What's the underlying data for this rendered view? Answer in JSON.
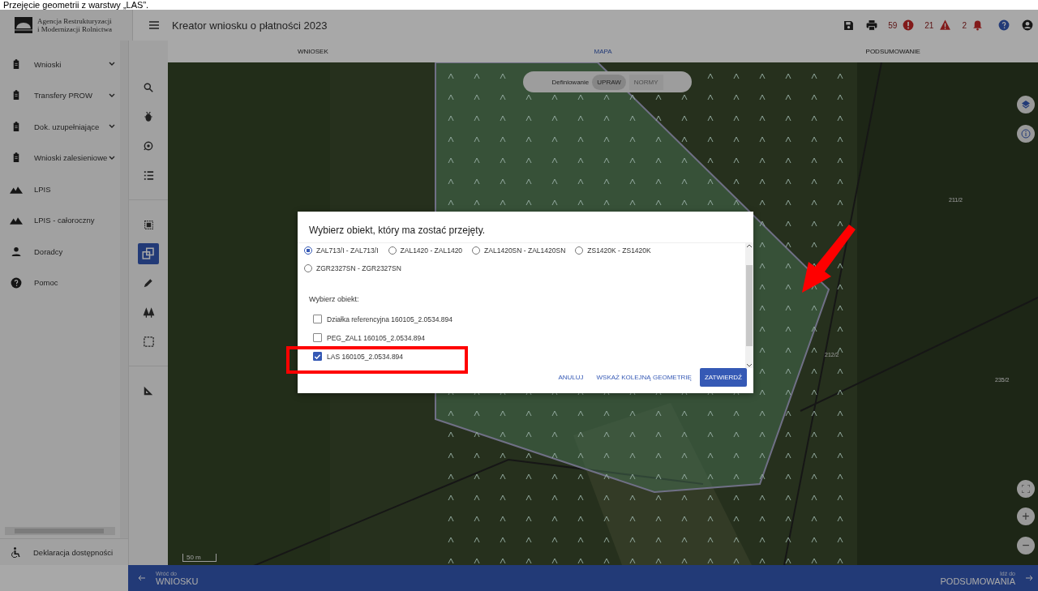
{
  "caption": "Przejęcie geometrii z warstwy „LAS”.",
  "header": {
    "logo_lines": [
      "Agencja Restrukturyzacji",
      "i Modernizacji Rolnictwa"
    ],
    "title": "Kreator wniosku o płatności 2023",
    "counters": [
      {
        "count": "59",
        "kind": "error"
      },
      {
        "count": "21",
        "kind": "warning"
      },
      {
        "count": "2",
        "kind": "notice"
      }
    ]
  },
  "tabs": [
    {
      "label": "WNIOSEK",
      "selected": false
    },
    {
      "label": "MAPA",
      "selected": true
    },
    {
      "label": "PODSUMOWANIE",
      "selected": false
    }
  ],
  "sidebar": {
    "items": [
      {
        "label": "Wnioski",
        "kind": "document",
        "expandable": true
      },
      {
        "label": "Transfery PROW",
        "kind": "document",
        "expandable": true
      },
      {
        "label": "Dok. uzupełniające",
        "kind": "document",
        "expandable": true
      },
      {
        "label": "Wnioski zalesieniowe",
        "kind": "document",
        "expandable": true
      },
      {
        "label": "LPIS",
        "kind": "terrain",
        "expandable": false
      },
      {
        "label": "LPIS - całoroczny",
        "kind": "terrain",
        "expandable": false
      },
      {
        "label": "Doradcy",
        "kind": "person",
        "expandable": false
      },
      {
        "label": "Pomoc",
        "kind": "help",
        "expandable": false
      }
    ],
    "footer": "Deklaracja dostępności"
  },
  "tools": [
    {
      "kind": "search",
      "selected": false
    },
    {
      "kind": "bug",
      "selected": false
    },
    {
      "kind": "target",
      "selected": false
    },
    {
      "kind": "list",
      "selected": false
    },
    {
      "kind": "sep"
    },
    {
      "kind": "frame",
      "selected": false
    },
    {
      "kind": "copy",
      "selected": true
    },
    {
      "kind": "pencil",
      "selected": false
    },
    {
      "kind": "trees",
      "selected": false
    },
    {
      "kind": "dashed",
      "selected": false
    },
    {
      "kind": "sep"
    },
    {
      "kind": "ruler",
      "selected": false
    }
  ],
  "map": {
    "toggle": {
      "label": "Definiowanie",
      "options": [
        {
          "label": "UPRAW",
          "selected": true
        },
        {
          "label": "NORMY",
          "selected": false
        }
      ]
    },
    "parcel_labels": [
      "211/2",
      "212/2",
      "235/2"
    ],
    "scale": "50 m",
    "zoom_in": "+",
    "zoom_out": "−"
  },
  "dialog": {
    "title": "Wybierz obiekt, który ma zostać przejęty.",
    "options": [
      {
        "label": "ZAL713/I - ZAL713/I",
        "selected": true
      },
      {
        "label": "ZAL1420 - ZAL1420",
        "selected": false
      },
      {
        "label": "ZAL1420SN - ZAL1420SN",
        "selected": false
      },
      {
        "label": "ZS1420K - ZS1420K",
        "selected": false
      },
      {
        "label": "ZGR2327SN - ZGR2327SN",
        "selected": false
      }
    ],
    "objects_label": "Wybierz obiekt:",
    "objects": [
      {
        "label": "Działka referencyjna 160105_2.0534.894",
        "checked": false
      },
      {
        "label": "PEG_ZAL1 160105_2.0534.894",
        "checked": false
      },
      {
        "label": "LAS 160105_2.0534.894",
        "checked": true
      }
    ],
    "buttons": [
      {
        "label": "ANULUJ",
        "kind": "text"
      },
      {
        "label": "WSKAŻ KOLEJNĄ GEOMETRIĘ",
        "kind": "text"
      },
      {
        "label": "ZATWIERDŹ",
        "kind": "primary"
      }
    ]
  },
  "bottom_bar": {
    "back_hint": "Wróć do",
    "back": "WNIOSKU",
    "next_hint": "Idź do",
    "next": "PODSUMOWANIA"
  }
}
